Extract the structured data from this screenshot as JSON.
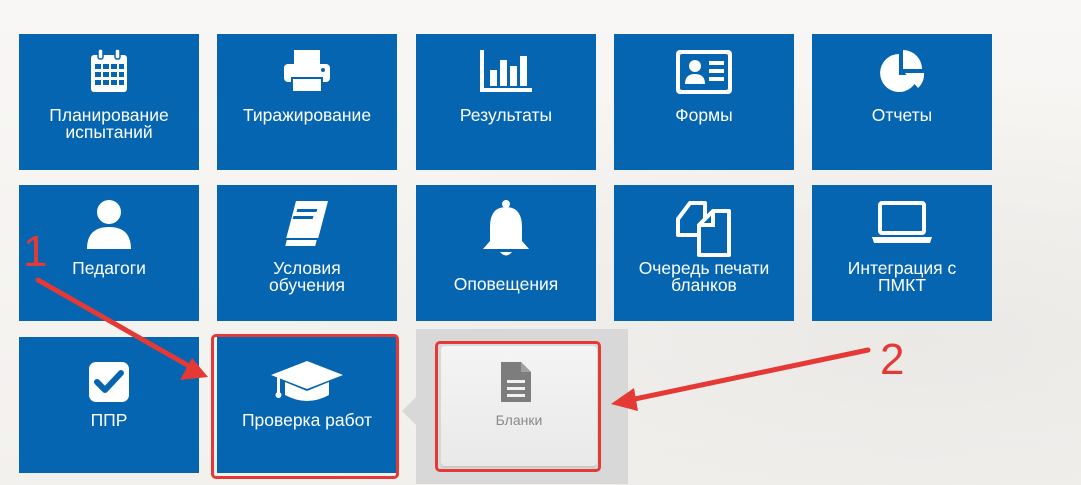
{
  "tiles": {
    "planning": "Планирование\nиспытаний",
    "replication": "Тиражирование",
    "results": "Результаты",
    "forms": "Формы",
    "reports": "Отчеты",
    "teachers": "Педагоги",
    "conditions": "Условия\nобучения",
    "notifications": "Оповещения",
    "print_queue": "Очередь печати\nбланков",
    "integration": "Интеграция с\nПМКТ",
    "ppr": "ППР",
    "check_works": "Проверка работ"
  },
  "submenu": {
    "blanks": "Бланки"
  },
  "annotations": {
    "callout_1": "1",
    "callout_2": "2"
  },
  "colors": {
    "tile_bg": "#0565b1",
    "highlight": "#e53935",
    "submenu_bg": "#d8d8d8"
  },
  "icons": {
    "planning": "calendar-icon",
    "replication": "printer-icon",
    "results": "bar-chart-icon",
    "forms": "id-card-icon",
    "reports": "pie-chart-icon",
    "teachers": "user-icon",
    "conditions": "book-icon",
    "notifications": "bell-icon",
    "print_queue": "copy-documents-icon",
    "integration": "laptop-icon",
    "ppr": "checkbox-icon",
    "check_works": "graduation-cap-icon",
    "blanks": "document-icon"
  }
}
